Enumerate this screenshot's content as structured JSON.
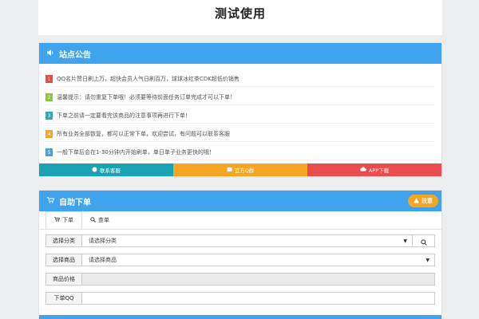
{
  "header": {
    "title": "测试使用"
  },
  "notice_card": {
    "title": "站点公告",
    "items": [
      {
        "num": "1",
        "color": "#e84c3d",
        "text": "QQ名片赞日刷上万，超快会员人气日刷百万，球球冰红茶CDK超低价销售"
      },
      {
        "num": "2",
        "color": "#8dc63f",
        "text": "温馨提示：请勿重复下单哦！必须要等待前面任务订单完成才可以下单！"
      },
      {
        "num": "3",
        "color": "#20b0b8",
        "text": "下单之前请一定要看完该商品的注意事项再进行下单！"
      },
      {
        "num": "4",
        "color": "#f5a623",
        "text": "所有业务全部恢复，都可以正常下单，欢迎尝试，有问题可以联系客服"
      },
      {
        "num": "5",
        "color": "#3fa3ee",
        "text": "一般下单后会在1-30分钟内开始刷单，单日单子业务更快的哦！"
      }
    ],
    "buttons": [
      {
        "label": "联系客服",
        "color": "#1aa2b4"
      },
      {
        "label": "官方Q群",
        "color": "#f5a623"
      },
      {
        "label": "APP下载",
        "color": "#e84c4c"
      }
    ]
  },
  "order_card": {
    "title": "自助下单",
    "badge": "注意",
    "tabs": [
      {
        "label": "下单",
        "active": true
      },
      {
        "label": "查单",
        "active": false
      }
    ],
    "form": {
      "category_label": "选择分类",
      "category_value": "请选择分类",
      "product_label": "选择商品",
      "product_value": "请选择商品",
      "price_label": "商品价格",
      "price_value": "",
      "qq_label": "下单QQ",
      "qq_value": ""
    }
  }
}
